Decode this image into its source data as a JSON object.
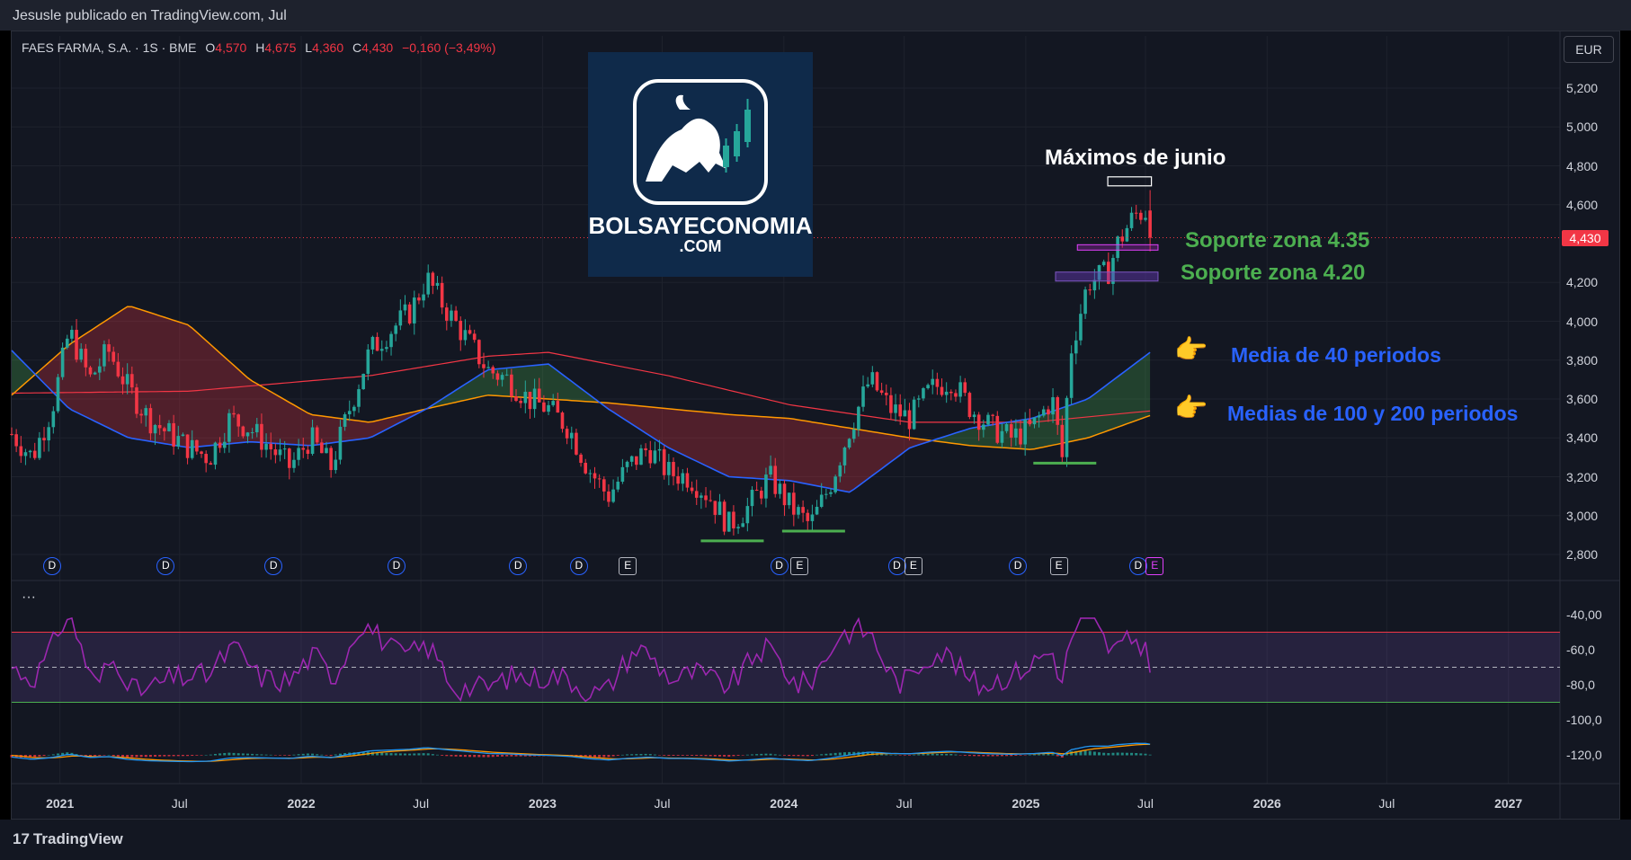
{
  "header": {
    "published": "Jesusle publicado en TradingView.com, Jul"
  },
  "legend": {
    "symbol": "FAES FARMA, S.A. · 1S · BME",
    "o_label": "O",
    "o_value": "4,570",
    "h_label": "H",
    "h_value": "4,675",
    "l_label": "L",
    "l_value": "4,360",
    "c_label": "C",
    "c_value": "4,430",
    "change": "−0,160 (−3,49%)"
  },
  "currency": "EUR",
  "price_tag": "4,430",
  "logo": {
    "line1": "BOLSAYECONOMIA",
    "line2": ".COM"
  },
  "annotations": {
    "maximos": "Máximos de junio",
    "soporte_435": "Soporte zona 4.35",
    "soporte_420": "Soporte zona 4.20",
    "media40": "Media de 40 periodos",
    "medias100_200": "Medias de 100 y 200 periodos"
  },
  "footer": {
    "brand": "TradingView"
  },
  "colors": {
    "up": "#26a69a",
    "down": "#f23645",
    "ma40": "#2962ff",
    "ma100": "#ff9800",
    "ma200": "#f23645",
    "rsi": "#9c27b0",
    "macd": "#2196f3",
    "signal": "#ff9800",
    "annotation_green": "#4caf50"
  },
  "events": [
    {
      "type": "D"
    },
    {
      "type": "D"
    },
    {
      "type": "D"
    },
    {
      "type": "D"
    },
    {
      "type": "D"
    },
    {
      "type": "D"
    },
    {
      "type": "E"
    },
    {
      "type": "D"
    },
    {
      "type": "E"
    },
    {
      "type": "D"
    },
    {
      "type": "E"
    },
    {
      "type": "D"
    },
    {
      "type": "E"
    },
    {
      "type": "D"
    },
    {
      "type": "E"
    }
  ],
  "chart_data": [
    {
      "type": "candlestick",
      "title": "FAES FARMA, S.A. · 1S · BME",
      "y_ticks": [
        "5,200",
        "5,000",
        "4,800",
        "4,600",
        "4,200",
        "4,000",
        "3,800",
        "3,600",
        "3,400",
        "3,200",
        "3,000",
        "2,800"
      ],
      "x_ticks": [
        "2021",
        "Jul",
        "2022",
        "Jul",
        "2023",
        "Jul",
        "2024",
        "Jul",
        "2025",
        "Jul",
        "2026",
        "Jul",
        "2027"
      ],
      "ylim": [
        2.72,
        5.32
      ],
      "xlim": [
        "2020-10-20",
        "2027-03-20"
      ],
      "close_path": [
        [
          "2020-10-20",
          3.42
        ],
        [
          "2020-11-20",
          3.3
        ],
        [
          "2020-12-20",
          3.55
        ],
        [
          "2021-01-15",
          3.95
        ],
        [
          "2021-02-15",
          3.7
        ],
        [
          "2021-03-15",
          3.85
        ],
        [
          "2021-04-15",
          3.65
        ],
        [
          "2021-05-15",
          3.5
        ],
        [
          "2021-06-15",
          3.42
        ],
        [
          "2021-07-15",
          3.35
        ],
        [
          "2021-08-15",
          3.3
        ],
        [
          "2021-09-15",
          3.5
        ],
        [
          "2021-10-15",
          3.45
        ],
        [
          "2021-11-15",
          3.35
        ],
        [
          "2021-12-15",
          3.25
        ],
        [
          "2022-01-15",
          3.4
        ],
        [
          "2022-02-15",
          3.25
        ],
        [
          "2022-03-15",
          3.55
        ],
        [
          "2022-04-15",
          3.85
        ],
        [
          "2022-05-15",
          3.95
        ],
        [
          "2022-06-15",
          4.05
        ],
        [
          "2022-07-10",
          4.22
        ],
        [
          "2022-08-10",
          4.05
        ],
        [
          "2022-09-10",
          3.9
        ],
        [
          "2022-10-10",
          3.75
        ],
        [
          "2022-11-10",
          3.7
        ],
        [
          "2022-12-10",
          3.6
        ],
        [
          "2023-01-10",
          3.55
        ],
        [
          "2023-02-10",
          3.45
        ],
        [
          "2023-03-10",
          3.25
        ],
        [
          "2023-04-10",
          3.1
        ],
        [
          "2023-05-10",
          3.25
        ],
        [
          "2023-06-10",
          3.35
        ],
        [
          "2023-07-10",
          3.22
        ],
        [
          "2023-08-10",
          3.2
        ],
        [
          "2023-09-10",
          3.1
        ],
        [
          "2023-10-10",
          2.95
        ],
        [
          "2023-11-10",
          3.05
        ],
        [
          "2023-12-10",
          3.2
        ],
        [
          "2024-01-10",
          3.05
        ],
        [
          "2024-02-10",
          2.95
        ],
        [
          "2024-03-10",
          3.15
        ],
        [
          "2024-04-10",
          3.45
        ],
        [
          "2024-05-10",
          3.7
        ],
        [
          "2024-06-10",
          3.55
        ],
        [
          "2024-07-10",
          3.5
        ],
        [
          "2024-08-10",
          3.65
        ],
        [
          "2024-09-10",
          3.7
        ],
        [
          "2024-10-10",
          3.55
        ],
        [
          "2024-11-10",
          3.45
        ],
        [
          "2024-12-10",
          3.4
        ],
        [
          "2025-01-10",
          3.45
        ],
        [
          "2025-02-10",
          3.6
        ],
        [
          "2025-02-25",
          3.3
        ],
        [
          "2025-03-10",
          3.85
        ],
        [
          "2025-04-05",
          4.2
        ],
        [
          "2025-05-05",
          4.25
        ],
        [
          "2025-05-20",
          4.4
        ],
        [
          "2025-06-15",
          4.55
        ],
        [
          "2025-07-05",
          4.57
        ],
        [
          "2025-07-12",
          4.43
        ]
      ],
      "last": {
        "open": 4.57,
        "high": 4.675,
        "low": 4.36,
        "close": 4.43
      },
      "ma40": [
        [
          "2020-10-20",
          3.85
        ],
        [
          "2021-01-15",
          3.55
        ],
        [
          "2021-04-15",
          3.4
        ],
        [
          "2021-07-15",
          3.35
        ],
        [
          "2021-10-15",
          3.38
        ],
        [
          "2022-01-15",
          3.36
        ],
        [
          "2022-04-15",
          3.4
        ],
        [
          "2022-07-10",
          3.55
        ],
        [
          "2022-10-10",
          3.75
        ],
        [
          "2023-01-10",
          3.78
        ],
        [
          "2023-04-10",
          3.55
        ],
        [
          "2023-07-10",
          3.35
        ],
        [
          "2023-10-10",
          3.2
        ],
        [
          "2024-01-10",
          3.18
        ],
        [
          "2024-04-10",
          3.12
        ],
        [
          "2024-07-10",
          3.35
        ],
        [
          "2024-10-10",
          3.45
        ],
        [
          "2025-01-10",
          3.5
        ],
        [
          "2025-04-05",
          3.6
        ],
        [
          "2025-07-12",
          3.85
        ]
      ],
      "ma100": [
        [
          "2020-10-20",
          3.62
        ],
        [
          "2021-01-15",
          3.88
        ],
        [
          "2021-04-15",
          4.08
        ],
        [
          "2021-07-15",
          3.98
        ],
        [
          "2021-10-15",
          3.7
        ],
        [
          "2022-01-15",
          3.52
        ],
        [
          "2022-04-15",
          3.48
        ],
        [
          "2022-07-10",
          3.55
        ],
        [
          "2022-10-10",
          3.62
        ],
        [
          "2023-01-10",
          3.6
        ],
        [
          "2023-04-10",
          3.58
        ],
        [
          "2023-07-10",
          3.55
        ],
        [
          "2023-10-10",
          3.52
        ],
        [
          "2024-01-10",
          3.5
        ],
        [
          "2024-04-10",
          3.45
        ],
        [
          "2024-07-10",
          3.4
        ],
        [
          "2024-10-10",
          3.36
        ],
        [
          "2025-01-10",
          3.34
        ],
        [
          "2025-04-05",
          3.4
        ],
        [
          "2025-07-12",
          3.52
        ]
      ],
      "ma200": [
        [
          "2020-10-20",
          3.63
        ],
        [
          "2021-07-15",
          3.64
        ],
        [
          "2022-04-15",
          3.72
        ],
        [
          "2022-10-10",
          3.82
        ],
        [
          "2023-01-10",
          3.84
        ],
        [
          "2023-07-10",
          3.72
        ],
        [
          "2024-01-10",
          3.57
        ],
        [
          "2024-07-10",
          3.48
        ],
        [
          "2025-01-10",
          3.48
        ],
        [
          "2025-07-12",
          3.54
        ]
      ],
      "zones": [
        {
          "label": "Soporte zona 4.35",
          "value": 4.38
        },
        {
          "label": "Soporte zona 4.20",
          "value": 4.23
        },
        {
          "label": "Máximos de junio",
          "value": 4.72
        }
      ],
      "lows_marked": [
        {
          "date": "2023-10-15",
          "value": 2.87
        },
        {
          "date": "2024-02-15",
          "value": 2.92
        },
        {
          "date": "2025-03-01",
          "value": 3.27
        }
      ]
    },
    {
      "type": "line",
      "name": "RSI-type oscillator",
      "y_ticks": [
        "-40,00",
        "-60,0",
        "-80,0",
        "-100,0",
        "-120,0"
      ],
      "levels": [
        -50,
        -70,
        -90
      ]
    }
  ]
}
